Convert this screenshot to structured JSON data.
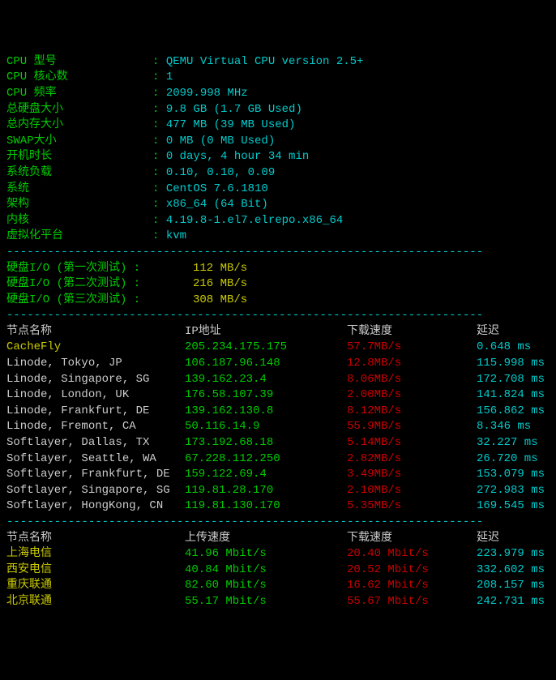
{
  "sys": {
    "items": [
      {
        "label": "CPU 型号",
        "value": "QEMU Virtual CPU version 2.5+"
      },
      {
        "label": "CPU 核心数",
        "value": "1"
      },
      {
        "label": "CPU 频率",
        "value": "2099.998 MHz"
      },
      {
        "label": "总硬盘大小",
        "value": "9.8 GB (1.7 GB Used)"
      },
      {
        "label": "总内存大小",
        "value": "477 MB (39 MB Used)"
      },
      {
        "label": "SWAP大小",
        "value": "0 MB (0 MB Used)"
      },
      {
        "label": "开机时长",
        "value": "0 days, 4 hour 34 min"
      },
      {
        "label": "系统负载",
        "value": "0.10, 0.10, 0.09"
      },
      {
        "label": "系统",
        "value": "CentOS 7.6.1810"
      },
      {
        "label": "架构",
        "value": "x86_64 (64 Bit)"
      },
      {
        "label": "内核",
        "value": "4.19.8-1.el7.elrepo.x86_64"
      },
      {
        "label": "虚拟化平台",
        "value": "kvm"
      }
    ]
  },
  "divider": "----------------------------------------------------------------------",
  "io": {
    "items": [
      {
        "label": "硬盘I/O (第一次测试) :",
        "value": "112 MB/s"
      },
      {
        "label": "硬盘I/O (第二次测试) :",
        "value": "216 MB/s"
      },
      {
        "label": "硬盘I/O (第三次测试) :",
        "value": "308 MB/s"
      }
    ]
  },
  "dlheader": {
    "node": "节点名称",
    "ip": "IP地址",
    "speed": "下载速度",
    "lat": "延迟"
  },
  "dl": [
    {
      "node": "CacheFly",
      "ip": "205.234.175.175",
      "speed": "57.7MB/s",
      "lat": "0.648 ms",
      "nodeColor": "yellow"
    },
    {
      "node": "Linode, Tokyo, JP",
      "ip": "106.187.96.148",
      "speed": "12.8MB/s",
      "lat": "115.998 ms",
      "nodeColor": "white"
    },
    {
      "node": "Linode, Singapore, SG",
      "ip": "139.162.23.4",
      "speed": "8.06MB/s",
      "lat": "172.708 ms",
      "nodeColor": "white"
    },
    {
      "node": "Linode, London, UK",
      "ip": "176.58.107.39",
      "speed": "2.00MB/s",
      "lat": "141.824 ms",
      "nodeColor": "white"
    },
    {
      "node": "Linode, Frankfurt, DE",
      "ip": "139.162.130.8",
      "speed": "8.12MB/s",
      "lat": "156.862 ms",
      "nodeColor": "white"
    },
    {
      "node": "Linode, Fremont, CA",
      "ip": "50.116.14.9",
      "speed": "55.9MB/s",
      "lat": "8.346 ms",
      "nodeColor": "white"
    },
    {
      "node": "Softlayer, Dallas, TX",
      "ip": "173.192.68.18",
      "speed": "5.14MB/s",
      "lat": "32.227 ms",
      "nodeColor": "white"
    },
    {
      "node": "Softlayer, Seattle, WA",
      "ip": "67.228.112.250",
      "speed": "2.82MB/s",
      "lat": "26.720 ms",
      "nodeColor": "white"
    },
    {
      "node": "Softlayer, Frankfurt, DE",
      "ip": "159.122.69.4",
      "speed": "3.49MB/s",
      "lat": "153.079 ms",
      "nodeColor": "white"
    },
    {
      "node": "Softlayer, Singapore, SG",
      "ip": "119.81.28.170",
      "speed": "2.10MB/s",
      "lat": "272.983 ms",
      "nodeColor": "white"
    },
    {
      "node": "Softlayer, HongKong, CN",
      "ip": "119.81.130.170",
      "speed": "5.35MB/s",
      "lat": "169.545 ms",
      "nodeColor": "white"
    }
  ],
  "ulheader": {
    "node": "节点名称",
    "up": "上传速度",
    "down": "下载速度",
    "lat": "延迟"
  },
  "ul": [
    {
      "node": "上海电信",
      "up": "41.96 Mbit/s",
      "down": "20.40 Mbit/s",
      "lat": "223.979 ms"
    },
    {
      "node": "西安电信",
      "up": "40.84 Mbit/s",
      "down": "20.52 Mbit/s",
      "lat": "332.602 ms"
    },
    {
      "node": "重庆联通",
      "up": "82.60 Mbit/s",
      "down": "16.62 Mbit/s",
      "lat": "208.157 ms"
    },
    {
      "node": "北京联通",
      "up": "55.17 Mbit/s",
      "down": "55.67 Mbit/s",
      "lat": "242.731 ms"
    }
  ]
}
